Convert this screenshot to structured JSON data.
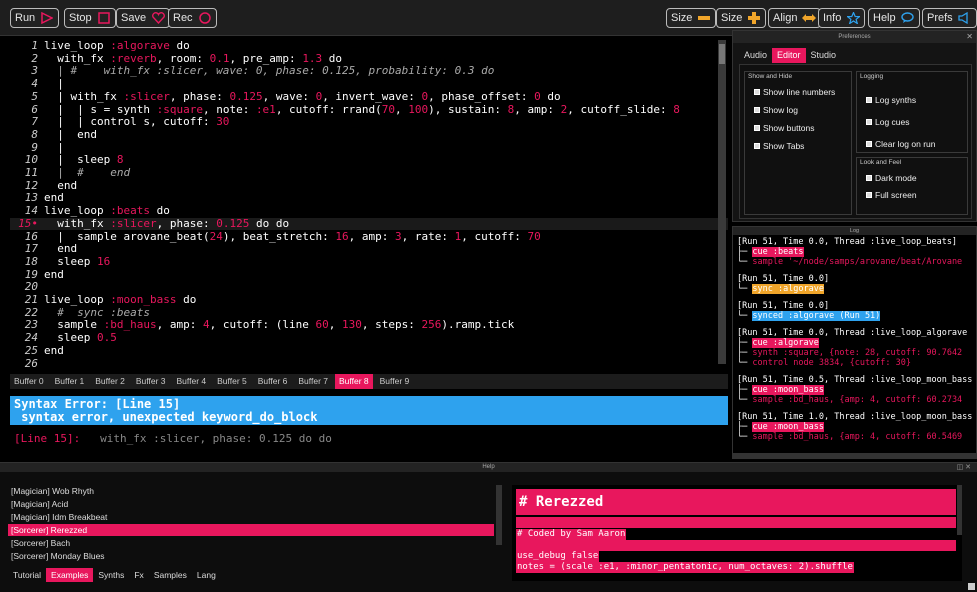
{
  "toolbar": {
    "run": "Run",
    "stop": "Stop",
    "save": "Save",
    "rec": "Rec",
    "size_minus": "Size",
    "size_plus": "Size",
    "align": "Align",
    "info": "Info",
    "help": "Help",
    "prefs": "Prefs"
  },
  "editor": {
    "lines": [
      {
        "n": "1",
        "segs": [
          [
            "k",
            "live_loop "
          ],
          [
            "sym",
            ":algorave"
          ],
          [
            "k",
            " do"
          ]
        ]
      },
      {
        "n": "2",
        "segs": [
          [
            "k",
            "  with_fx "
          ],
          [
            "sym",
            ":reverb"
          ],
          [
            "k",
            ", room: "
          ],
          [
            "num",
            "0.1"
          ],
          [
            "k",
            ", pre_amp: "
          ],
          [
            "num",
            "1.3"
          ],
          [
            "k",
            " do"
          ]
        ]
      },
      {
        "n": "3",
        "segs": [
          [
            "com",
            "  | #    with_fx :slicer, wave: 0, phase: 0.125, probability: 0.3 do"
          ]
        ]
      },
      {
        "n": "4",
        "segs": [
          [
            "k",
            "  |"
          ]
        ]
      },
      {
        "n": "5",
        "segs": [
          [
            "k",
            "  | with_fx "
          ],
          [
            "sym",
            ":slicer"
          ],
          [
            "k",
            ", phase: "
          ],
          [
            "num",
            "0.125"
          ],
          [
            "k",
            ", wave: "
          ],
          [
            "num",
            "0"
          ],
          [
            "k",
            ", invert_wave: "
          ],
          [
            "num",
            "0"
          ],
          [
            "k",
            ", phase_offset: "
          ],
          [
            "num",
            "0"
          ],
          [
            "k",
            " do"
          ]
        ]
      },
      {
        "n": "6",
        "segs": [
          [
            "k",
            "  |  | s = synth "
          ],
          [
            "sym",
            ":square"
          ],
          [
            "k",
            ", note: "
          ],
          [
            "sym",
            ":e1"
          ],
          [
            "k",
            ", cutoff: rrand("
          ],
          [
            "num",
            "70"
          ],
          [
            "k",
            ", "
          ],
          [
            "num",
            "100"
          ],
          [
            "k",
            "), sustain: "
          ],
          [
            "num",
            "8"
          ],
          [
            "k",
            ", amp: "
          ],
          [
            "num",
            "2"
          ],
          [
            "k",
            ", cutoff_slide: "
          ],
          [
            "num",
            "8"
          ]
        ]
      },
      {
        "n": "7",
        "segs": [
          [
            "k",
            "  |  | control s, cutoff: "
          ],
          [
            "num",
            "30"
          ]
        ]
      },
      {
        "n": "8",
        "segs": [
          [
            "k",
            "  |  end"
          ]
        ]
      },
      {
        "n": "9",
        "segs": [
          [
            "k",
            "  |"
          ]
        ]
      },
      {
        "n": "10",
        "segs": [
          [
            "k",
            "  |  sleep "
          ],
          [
            "num",
            "8"
          ]
        ]
      },
      {
        "n": "11",
        "segs": [
          [
            "com",
            "  |  #    end"
          ]
        ]
      },
      {
        "n": "12",
        "segs": [
          [
            "k",
            "  end"
          ]
        ]
      },
      {
        "n": "13",
        "segs": [
          [
            "k",
            "end"
          ]
        ]
      },
      {
        "n": "14",
        "segs": [
          [
            "k",
            "live_loop "
          ],
          [
            "sym",
            ":beats"
          ],
          [
            "k",
            " do"
          ]
        ]
      },
      {
        "n": "15",
        "err": true,
        "segs": [
          [
            "k",
            "  with_fx "
          ],
          [
            "sym",
            ":slicer"
          ],
          [
            "k",
            ", phase: "
          ],
          [
            "num",
            "0.125"
          ],
          [
            "k",
            " do do"
          ]
        ]
      },
      {
        "n": "16",
        "segs": [
          [
            "k",
            "  |  sample arovane_beat("
          ],
          [
            "num",
            "24"
          ],
          [
            "k",
            "), beat_stretch: "
          ],
          [
            "num",
            "16"
          ],
          [
            "k",
            ", amp: "
          ],
          [
            "num",
            "3"
          ],
          [
            "k",
            ", rate: "
          ],
          [
            "num",
            "1"
          ],
          [
            "k",
            ", cutoff: "
          ],
          [
            "num",
            "70"
          ]
        ]
      },
      {
        "n": "17",
        "segs": [
          [
            "k",
            "  end"
          ]
        ]
      },
      {
        "n": "18",
        "segs": [
          [
            "k",
            "  sleep "
          ],
          [
            "num",
            "16"
          ]
        ]
      },
      {
        "n": "19",
        "segs": [
          [
            "k",
            "end"
          ]
        ]
      },
      {
        "n": "20",
        "segs": [
          [
            "k",
            ""
          ]
        ]
      },
      {
        "n": "21",
        "segs": [
          [
            "k",
            "live_loop "
          ],
          [
            "sym",
            ":moon_bass"
          ],
          [
            "k",
            " do"
          ]
        ]
      },
      {
        "n": "22",
        "segs": [
          [
            "com",
            "  #  sync :beats"
          ]
        ]
      },
      {
        "n": "23",
        "segs": [
          [
            "k",
            "  sample "
          ],
          [
            "sym",
            ":bd_haus"
          ],
          [
            "k",
            ", amp: "
          ],
          [
            "num",
            "4"
          ],
          [
            "k",
            ", cutoff: (line "
          ],
          [
            "num",
            "60"
          ],
          [
            "k",
            ", "
          ],
          [
            "num",
            "130"
          ],
          [
            "k",
            ", steps: "
          ],
          [
            "num",
            "256"
          ],
          [
            "k",
            ").ramp.tick"
          ]
        ]
      },
      {
        "n": "24",
        "segs": [
          [
            "k",
            "  sleep "
          ],
          [
            "num",
            "0.5"
          ]
        ]
      },
      {
        "n": "25",
        "segs": [
          [
            "k",
            "end"
          ]
        ]
      },
      {
        "n": "26",
        "segs": [
          [
            "k",
            ""
          ]
        ]
      }
    ]
  },
  "buffers": [
    "Buffer 0",
    "Buffer 1",
    "Buffer 2",
    "Buffer 3",
    "Buffer 4",
    "Buffer 5",
    "Buffer 6",
    "Buffer 7",
    "Buffer 8",
    "Buffer 9"
  ],
  "active_buffer": 8,
  "error": {
    "title": "Syntax Error: [Line 15]",
    "message": " syntax error, unexpected keyword_do_block",
    "line_ref": "[Line 15]:",
    "line_code": "   with_fx :slicer, phase: 0.125 do do"
  },
  "prefs": {
    "title": "Preferences",
    "tabs": [
      "Audio",
      "Editor",
      "Studio"
    ],
    "active_tab": 1,
    "show_hide": {
      "title": "Show and Hide",
      "items": [
        "Show line numbers",
        "Show log",
        "Show buttons",
        "Show Tabs"
      ]
    },
    "logging": {
      "title": "Logging",
      "items": [
        "Log synths",
        "Log cues",
        "Clear log on run"
      ]
    },
    "look": {
      "title": "Look and Feel",
      "items": [
        "Dark mode",
        "Full screen"
      ]
    }
  },
  "log": {
    "title": "Log",
    "entries": [
      {
        "head": "[Run 51, Time 0.0, Thread :live_loop_beats]",
        "rows": [
          [
            "├─ ",
            "pink",
            "cue :beats"
          ],
          [
            "└─ ",
            "pinktxt",
            "sample '~/node/samps/arovane/beat/Arovane"
          ]
        ]
      },
      {
        "head": "[Run 51, Time 0.0]",
        "rows": [
          [
            "└─ ",
            "orange",
            "sync :algorave"
          ]
        ]
      },
      {
        "head": "[Run 51, Time 0.0]",
        "rows": [
          [
            "└─ ",
            "blue",
            "synced :algorave (Run 51)"
          ]
        ]
      },
      {
        "head": "[Run 51, Time 0.0, Thread :live_loop_algorave",
        "rows": [
          [
            "├─ ",
            "pink",
            "cue :algorave"
          ],
          [
            "├─ ",
            "pinktxt",
            "synth :square, {note: 28, cutoff: 90.7642"
          ],
          [
            "└─ ",
            "pinktxt",
            "control node 3834, {cutoff: 30}"
          ]
        ]
      },
      {
        "head": "[Run 51, Time 0.5, Thread :live_loop_moon_bass",
        "rows": [
          [
            "├─ ",
            "pink",
            "cue :moon_bass"
          ],
          [
            "└─ ",
            "pinktxt",
            "sample :bd_haus, {amp: 4, cutoff: 60.2734"
          ]
        ]
      },
      {
        "head": "[Run 51, Time 1.0, Thread :live_loop_moon_bass",
        "rows": [
          [
            "├─ ",
            "pink",
            "cue :moon_bass"
          ],
          [
            "└─ ",
            "pinktxt",
            "sample :bd_haus, {amp: 4, cutoff: 60.5469"
          ]
        ]
      }
    ]
  },
  "help": {
    "title": "Help",
    "examples": [
      "[Magician] Wob Rhyth",
      "[Magician] Acid",
      "[Magician] Idm Breakbeat",
      "[Sorcerer] Rerezzed",
      "[Sorcerer] Bach",
      "[Sorcerer] Monday Blues"
    ],
    "selected_example": 3,
    "tabs": [
      "Tutorial",
      "Examples",
      "Synths",
      "Fx",
      "Samples",
      "Lang"
    ],
    "active_tab": 1,
    "doc_heading": "# Rerezzed",
    "doc_lines": [
      "# Coded by Sam Aaron",
      "use_debug false",
      "notes = (scale :e1, :minor_pentatonic, num_octaves: 2).shuffle"
    ]
  },
  "colors": {
    "accent": "#e8175d",
    "blue": "#2ea2ee",
    "orange": "#f0a52a"
  }
}
